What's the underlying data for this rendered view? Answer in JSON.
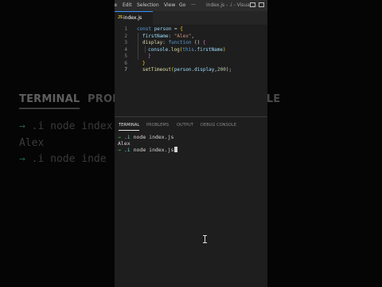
{
  "background": {
    "tabs": [
      "TERMINAL",
      "PROB",
      "SOLE"
    ],
    "lines": [
      {
        "prefix": "→",
        "text": " .i node index"
      },
      {
        "prefix": "",
        "text": "Alex"
      },
      {
        "prefix": "→",
        "text": " .i node inde"
      }
    ]
  },
  "menubar": {
    "items": [
      "ile",
      "Edit",
      "Selection",
      "View",
      "Go",
      "···"
    ],
    "title": "index.js - .i - Visual ..."
  },
  "editor_tab": {
    "icon": "JS",
    "name": "index.js"
  },
  "editor": {
    "line_numbers": [
      "1",
      "2",
      "3",
      "4",
      "5",
      "6",
      "7"
    ],
    "tokens": {
      "const": "const",
      "person": "person",
      "eq": " = ",
      "open": "{",
      "firstName_key": "firstName",
      "colon1": ": ",
      "alex_str": "\"Alex\"",
      "comma1": ",",
      "display_key": "display",
      "colon2": ": ",
      "function_kw": "function",
      "parens": " () ",
      "fopen": "{",
      "console": "console",
      "dot1": ".",
      "log": "log",
      "lp": "(",
      "this": "this",
      "dot2": ".",
      "firstName2": "firstName",
      "rp": ")",
      "fclose": "}",
      "close": "}",
      "setTimeout": "setTimeout",
      "lp2": "(",
      "person2": "person",
      "dot3": ".",
      "display2": "display",
      "comma2": ",",
      "num": "200",
      "rp2": ");"
    }
  },
  "panel": {
    "tabs": [
      "TERMINAL",
      "PROBLEMS",
      "OUTPUT",
      "DEBUG CONSOLE"
    ],
    "terminal": {
      "arrow": "→",
      "dir": ".i",
      "cmd1": " node index.js",
      "output": "Alex",
      "cmd2": " node index.js"
    }
  }
}
